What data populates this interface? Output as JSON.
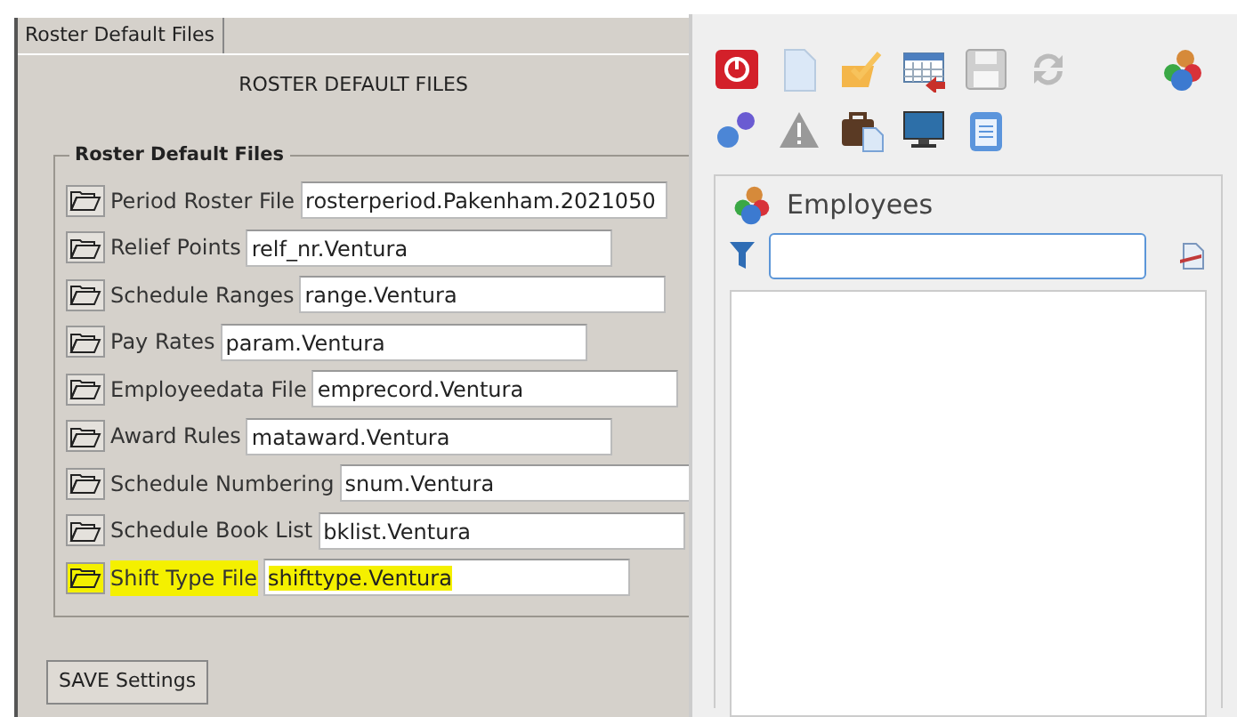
{
  "tabs": [
    {
      "label": "Roster Default Files",
      "selected": true
    }
  ],
  "heading": "ROSTER DEFAULT FILES",
  "group": {
    "title": "Roster Default Files",
    "fields": [
      {
        "label": "Period Roster File",
        "value": "rosterperiod.Pakenham.2021050",
        "highlighted": false
      },
      {
        "label": "Relief Points",
        "value": "relf_nr.Ventura",
        "highlighted": false
      },
      {
        "label": "Schedule Ranges",
        "value": "range.Ventura",
        "highlighted": false
      },
      {
        "label": "Pay Rates",
        "value": "param.Ventura",
        "highlighted": false
      },
      {
        "label": "Employeedata File",
        "value": "emprecord.Ventura",
        "highlighted": false
      },
      {
        "label": "Award Rules",
        "value": "mataward.Ventura",
        "highlighted": false
      },
      {
        "label": "Schedule Numbering",
        "value": "snum.Ventura",
        "highlighted": false
      },
      {
        "label": "Schedule Book List",
        "value": "bklist.Ventura",
        "highlighted": false
      },
      {
        "label": "Shift Type File",
        "value": "shifttype.Ventura",
        "highlighted": true
      }
    ]
  },
  "save_button": "SAVE Settings",
  "employees_panel": {
    "title": "Employees"
  }
}
